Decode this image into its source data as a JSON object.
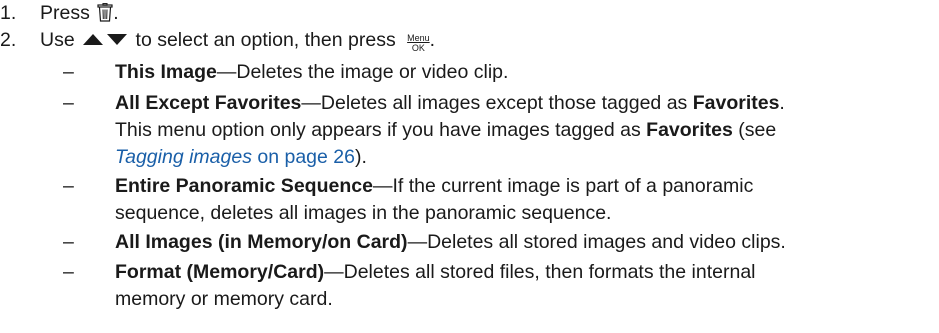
{
  "steps": [
    {
      "num": "1.",
      "text_before": "Press ",
      "icon": "trash-icon",
      "text_after": "."
    },
    {
      "num": "2.",
      "text_before": "Use ",
      "icon": "up-down-arrows-icon",
      "text_mid": " to select an option, then press ",
      "menu_top": "Menu",
      "menu_bottom": "OK",
      "text_after": "."
    }
  ],
  "options": [
    {
      "dash": "–",
      "title": "This Image",
      "separator": "—",
      "lines": [
        "Deletes the image or video clip."
      ]
    },
    {
      "dash": "–",
      "title": "All Except Favorites",
      "separator": "—",
      "line1_pre": "Deletes all images except those tagged as ",
      "line1_bold": "Favorites",
      "line1_post": ".",
      "line2_pre": "This menu option only appears if you have images tagged as ",
      "line2_bold": "Favorites",
      "line2_post": " (see",
      "line3_link": "Tagging images",
      "line3_page": " on page 26",
      "line3_post": ")."
    },
    {
      "dash": "–",
      "title": "Entire Panoramic Sequence",
      "separator": "—",
      "lines": [
        "If the current image is part of a panoramic",
        "sequence, deletes all images in the panoramic sequence."
      ]
    },
    {
      "dash": "–",
      "title": "All Images (in Memory/on Card)",
      "separator": "—",
      "lines": [
        "Deletes all stored images and video clips."
      ]
    },
    {
      "dash": "–",
      "title": "Format (Memory/Card)",
      "separator": "—",
      "lines": [
        "Deletes all stored files, then formats the internal",
        "memory or memory card."
      ]
    }
  ],
  "colors": {
    "text": "#1a1a1a",
    "link": "#1a5fa8"
  }
}
